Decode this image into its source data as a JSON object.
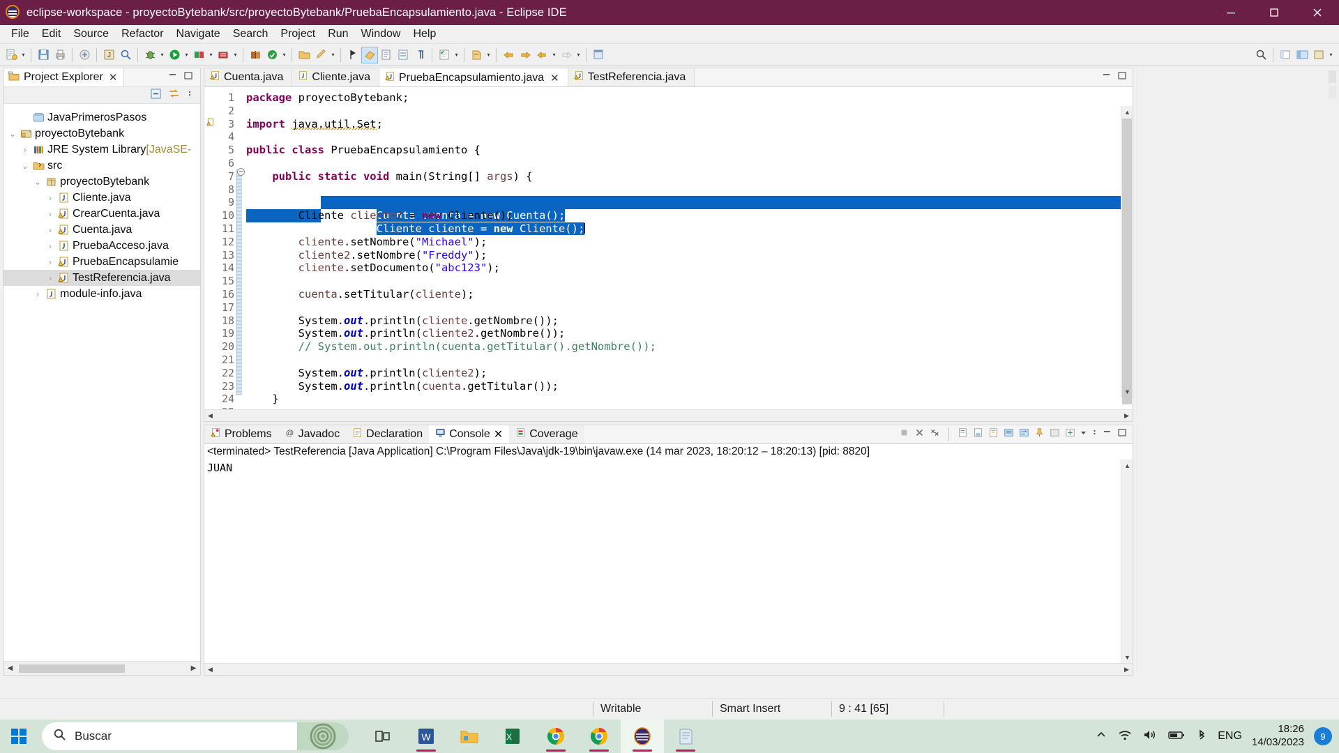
{
  "window": {
    "title": "eclipse-workspace - proyectoBytebank/src/proyectoBytebank/PruebaEncapsulamiento.java - Eclipse IDE",
    "titlebar_color": "#6b1e46",
    "minimize_label": "—",
    "maximize_label": "❐",
    "close_label": "✕"
  },
  "menubar": {
    "items": [
      {
        "label": "File"
      },
      {
        "label": "Edit"
      },
      {
        "label": "Source"
      },
      {
        "label": "Refactor"
      },
      {
        "label": "Navigate"
      },
      {
        "label": "Search"
      },
      {
        "label": "Project"
      },
      {
        "label": "Run"
      },
      {
        "label": "Window"
      },
      {
        "label": "Help"
      }
    ]
  },
  "explorer": {
    "tab_label": "Project Explorer",
    "tab_close": "✕",
    "tool_collapse_all": "collapse-all-icon",
    "tool_link_editor": "link-with-editor-icon",
    "tree": [
      {
        "label": "JavaPrimerosPasos",
        "indent": 1,
        "chev": "",
        "icon": "project-closed-icon",
        "selected": false
      },
      {
        "label": "proyectoBytebank",
        "indent": 0,
        "chev": "⌄",
        "icon": "java-project-icon",
        "selected": false
      },
      {
        "label": "JRE System Library",
        "suffix": " [JavaSE-",
        "indent": 1,
        "chev": "›",
        "icon": "library-icon",
        "selected": false
      },
      {
        "label": "src",
        "indent": 1,
        "chev": "⌄",
        "icon": "source-folder-icon",
        "selected": false
      },
      {
        "label": "proyectoBytebank",
        "indent": 2,
        "chev": "⌄",
        "icon": "package-icon",
        "selected": false
      },
      {
        "label": "Cliente.java",
        "indent": 3,
        "chev": "›",
        "icon": "java-file-icon",
        "selected": false
      },
      {
        "label": "CrearCuenta.java",
        "indent": 3,
        "chev": "›",
        "icon": "java-file-warning-icon",
        "selected": false
      },
      {
        "label": "Cuenta.java",
        "indent": 3,
        "chev": "›",
        "icon": "java-file-warning-icon",
        "selected": false
      },
      {
        "label": "PruebaAcceso.java",
        "indent": 3,
        "chev": "›",
        "icon": "java-file-icon",
        "selected": false
      },
      {
        "label": "PruebaEncapsulamie",
        "indent": 3,
        "chev": "›",
        "icon": "java-file-warning-icon",
        "selected": false
      },
      {
        "label": "TestReferencia.java",
        "indent": 3,
        "chev": "›",
        "icon": "java-file-warning-icon",
        "selected": true
      },
      {
        "label": "module-info.java",
        "indent": 2,
        "chev": "›",
        "icon": "java-file-icon",
        "selected": false
      }
    ]
  },
  "editor": {
    "tabs": [
      {
        "label": "Cuenta.java",
        "active": false,
        "closable": false,
        "icon": "java-file-warning-icon"
      },
      {
        "label": "Cliente.java",
        "active": false,
        "closable": false,
        "icon": "java-file-icon"
      },
      {
        "label": "PruebaEncapsulamiento.java",
        "active": true,
        "closable": true,
        "icon": "java-file-warning-icon"
      },
      {
        "label": "TestReferencia.java",
        "active": false,
        "closable": false,
        "icon": "java-file-warning-icon"
      }
    ],
    "tab_close": "✕",
    "lines": [
      {
        "n": "1",
        "text": "package proyectoBytebank;"
      },
      {
        "n": "2",
        "text": ""
      },
      {
        "n": "3",
        "text": "import java.util.Set;"
      },
      {
        "n": "4",
        "text": ""
      },
      {
        "n": "5",
        "text": "public class PruebaEncapsulamiento {"
      },
      {
        "n": "6",
        "text": ""
      },
      {
        "n": "7",
        "text": "    public static void main(String[] args) {"
      },
      {
        "n": "8",
        "text": "        Cuenta cuenta = new Cuenta();"
      },
      {
        "n": "9",
        "text": "        Cliente cliente = new Cliente();"
      },
      {
        "n": "10",
        "text": "        Cliente cliente2 = new Cliente();"
      },
      {
        "n": "11",
        "text": ""
      },
      {
        "n": "12",
        "text": "        cliente.setNombre(\"Michael\");"
      },
      {
        "n": "13",
        "text": "        cliente2.setNombre(\"Freddy\");"
      },
      {
        "n": "14",
        "text": "        cliente.setDocumento(\"abc123\");"
      },
      {
        "n": "15",
        "text": ""
      },
      {
        "n": "16",
        "text": "        cuenta.setTitular(cliente);"
      },
      {
        "n": "17",
        "text": ""
      },
      {
        "n": "18",
        "text": "        System.out.println(cliente.getNombre());"
      },
      {
        "n": "19",
        "text": "        System.out.println(cliente2.getNombre());"
      },
      {
        "n": "20",
        "text": "        // System.out.println(cuenta.getTitular().getNombre());"
      },
      {
        "n": "21",
        "text": ""
      },
      {
        "n": "22",
        "text": "        System.out.println(cliente2);"
      },
      {
        "n": "23",
        "text": "        System.out.println(cuenta.getTitular());"
      },
      {
        "n": "24",
        "text": "    }"
      },
      {
        "n": "25",
        "text": ""
      },
      {
        "n": "26",
        "text": "}"
      }
    ],
    "selection_color": "#0a65c2",
    "keyword_color": "#7f0055",
    "string_color": "#2a00ff",
    "comment_color": "#3f7f5f",
    "field_color": "#6a3e3e",
    "static_color": "#0000c0"
  },
  "console": {
    "tabs": [
      {
        "label": "Problems",
        "icon": "problems-icon",
        "active": false,
        "closable": false
      },
      {
        "label": "Javadoc",
        "icon": "javadoc-icon",
        "active": false,
        "closable": false
      },
      {
        "label": "Declaration",
        "icon": "declaration-icon",
        "active": false,
        "closable": false
      },
      {
        "label": "Console",
        "icon": "console-icon",
        "active": true,
        "closable": true
      },
      {
        "label": "Coverage",
        "icon": "coverage-icon",
        "active": false,
        "closable": false
      }
    ],
    "tab_close": "✕",
    "launch_line": "<terminated> TestReferencia [Java Application] C:\\Program Files\\Java\\jdk-19\\bin\\javaw.exe  (14 mar 2023, 18:20:12 – 18:20:13) [pid: 8820]",
    "output": "JUAN",
    "tools": [
      "terminate-icon",
      "remove-launch-icon",
      "remove-all-icon",
      "open-console-icon",
      "save-console-icon",
      "clear-console-icon",
      "scroll-lock-icon",
      "word-wrap-icon",
      "pin-console-icon",
      "display-console-icon",
      "open-console-menu-icon",
      "view-menu-icon",
      "minimize-icon",
      "maximize-icon"
    ]
  },
  "statusbar": {
    "writable": "Writable",
    "insert_mode": "Smart Insert",
    "position": "9 : 41 [65]"
  },
  "taskbar": {
    "start_label": "start-button",
    "search_placeholder": "Buscar",
    "apps": [
      {
        "name": "task-view",
        "running": false,
        "focused": false
      },
      {
        "name": "word",
        "running": true,
        "focused": false
      },
      {
        "name": "file-explorer",
        "running": false,
        "focused": false
      },
      {
        "name": "excel",
        "running": false,
        "focused": false
      },
      {
        "name": "chrome-1",
        "running": true,
        "focused": false
      },
      {
        "name": "chrome-2",
        "running": true,
        "focused": false
      },
      {
        "name": "eclipse",
        "running": true,
        "focused": true
      },
      {
        "name": "notepad",
        "running": true,
        "focused": false
      }
    ],
    "language": "ENG",
    "time": "18:26",
    "date": "14/03/2023",
    "notification_count": "9"
  }
}
